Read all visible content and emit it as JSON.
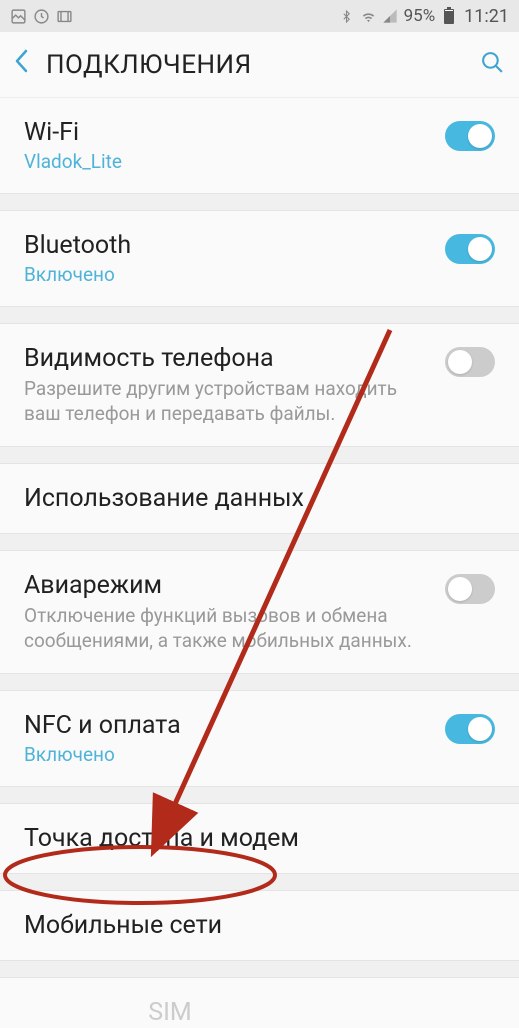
{
  "status_bar": {
    "battery_percent": "95%",
    "time": "11:21"
  },
  "header": {
    "title": "ПОДКЛЮЧЕНИЯ"
  },
  "items": {
    "wifi": {
      "title": "Wi-Fi",
      "subtitle": "Vladok_Lite",
      "toggle": true
    },
    "bluetooth": {
      "title": "Bluetooth",
      "subtitle": "Включено",
      "toggle": true
    },
    "visibility": {
      "title": "Видимость телефона",
      "description": "Разрешите другим устройствам находить ваш телефон и передавать файлы.",
      "toggle": false
    },
    "data_usage": {
      "title": "Использование данных"
    },
    "airplane": {
      "title": "Авиарежим",
      "description": "Отключение функций вызовов и обмена сообщениями, а также мобильных данных.",
      "toggle": false
    },
    "nfc": {
      "title": "NFC и оплата",
      "subtitle": "Включено",
      "toggle": true
    },
    "hotspot": {
      "title": "Точка доступа и модем"
    },
    "mobile_networks": {
      "title": "Мобильные сети"
    },
    "sim": {
      "title_partial": "SIM"
    }
  }
}
